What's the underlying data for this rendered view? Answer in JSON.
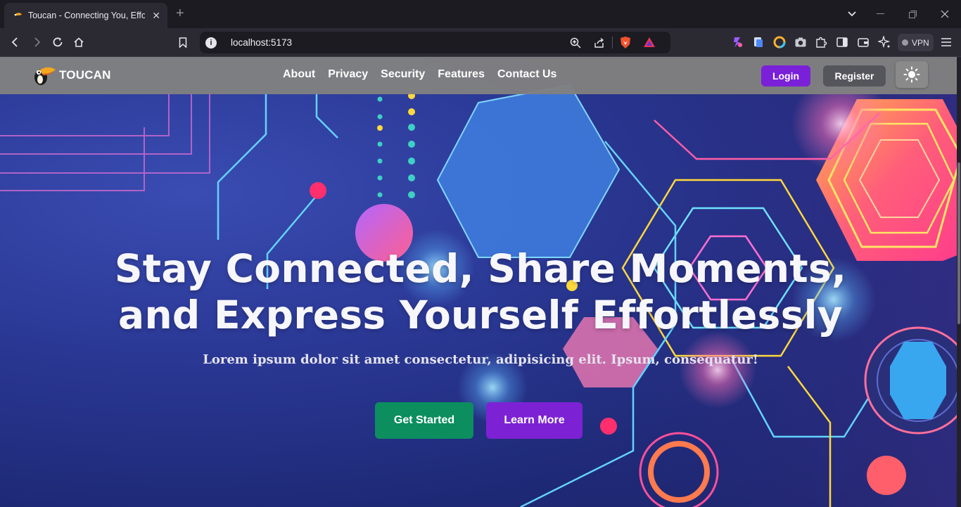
{
  "browser": {
    "tab_title": "Toucan - Connecting You, Effortlessly",
    "url": "localhost:5173",
    "vpn_label": "VPN"
  },
  "site": {
    "brand": "TOUCAN",
    "nav": [
      "About",
      "Privacy",
      "Security",
      "Features",
      "Contact Us"
    ],
    "login_label": "Login",
    "register_label": "Register"
  },
  "hero": {
    "headline_line1": "Stay Connected, Share Moments,",
    "headline_line2": "and Express Yourself Effortlessly",
    "subheading": "Lorem ipsum dolor sit amet consectetur, adipisicing elit. Ipsum, consequatur!",
    "cta_primary": "Get Started",
    "cta_secondary": "Learn More"
  },
  "colors": {
    "login_bg": "#7a20d8",
    "register_bg": "#55555c",
    "get_started_bg": "#0c8e5e",
    "learn_more_bg": "#7c22d4",
    "navbar_bg": "#808080"
  }
}
